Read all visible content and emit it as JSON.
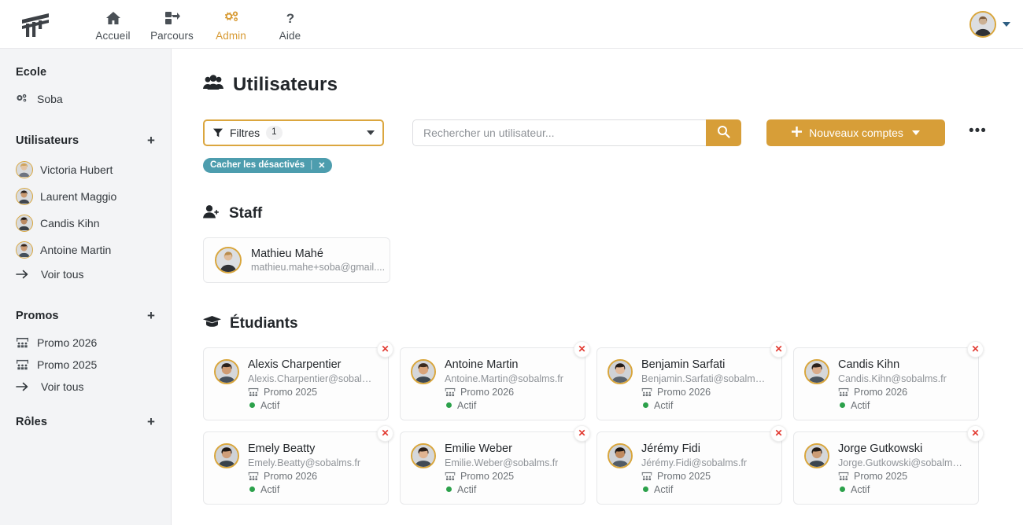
{
  "topnav": {
    "logo": "soba-logo",
    "items": [
      {
        "label": "Accueil",
        "icon": "home-icon",
        "active": false
      },
      {
        "label": "Parcours",
        "icon": "path-icon",
        "active": false
      },
      {
        "label": "Admin",
        "icon": "gears-icon",
        "active": true
      },
      {
        "label": "Aide",
        "icon": "question-icon",
        "active": false
      }
    ],
    "user_menu_caret": "caret-down-icon"
  },
  "sidebar": {
    "school": {
      "title": "Ecole",
      "items": [
        {
          "label": "Soba",
          "icon": "gears-icon"
        }
      ]
    },
    "users": {
      "title": "Utilisateurs",
      "add_label": "+",
      "items": [
        {
          "label": "Victoria Hubert"
        },
        {
          "label": "Laurent Maggio"
        },
        {
          "label": "Candis Kihn"
        },
        {
          "label": "Antoine Martin"
        }
      ],
      "see_all": "Voir tous"
    },
    "promos": {
      "title": "Promos",
      "add_label": "+",
      "items": [
        {
          "label": "Promo 2026"
        },
        {
          "label": "Promo 2025"
        }
      ],
      "see_all": "Voir tous"
    },
    "roles": {
      "title": "Rôles",
      "add_label": "+"
    }
  },
  "main": {
    "page_title": "Utilisateurs",
    "page_title_icon": "users-group-icon",
    "toolbar": {
      "filters_label": "Filtres",
      "filters_count": "1",
      "filters_icon": "funnel-icon",
      "search_placeholder": "Rechercher un utilisateur...",
      "search_value": "",
      "search_icon": "search-icon",
      "new_accounts_label": "Nouveaux comptes",
      "new_accounts_icon": "plus-icon",
      "more_label": "•••"
    },
    "active_filter_chip": {
      "label": "Cacher les désactivés",
      "separator": "|",
      "remove": "✕"
    },
    "staff_section": {
      "title": "Staff",
      "icon": "user-add-icon",
      "members": [
        {
          "name": "Mathieu Mahé",
          "email": "mathieu.mahe+soba@gmail...."
        }
      ]
    },
    "students_section": {
      "title": "Étudiants",
      "icon": "graduation-cap-icon",
      "promo_icon": "classroom-icon",
      "status_label": "Actif",
      "delete_label": "✕",
      "students": [
        {
          "name": "Alexis Charpentier",
          "email": "Alexis.Charpentier@sobalm...",
          "promo": "Promo 2025",
          "status": "Actif"
        },
        {
          "name": "Antoine Martin",
          "email": "Antoine.Martin@sobalms.fr",
          "promo": "Promo 2026",
          "status": "Actif"
        },
        {
          "name": "Benjamin Sarfati",
          "email": "Benjamin.Sarfati@sobalms.fr",
          "promo": "Promo 2026",
          "status": "Actif"
        },
        {
          "name": "Candis Kihn",
          "email": "Candis.Kihn@sobalms.fr",
          "promo": "Promo 2026",
          "status": "Actif"
        },
        {
          "name": "Emely Beatty",
          "email": "Emely.Beatty@sobalms.fr",
          "promo": "Promo 2026",
          "status": "Actif"
        },
        {
          "name": "Emilie Weber",
          "email": "Emilie.Weber@sobalms.fr",
          "promo": "Promo 2025",
          "status": "Actif"
        },
        {
          "name": "Jérémy Fidi",
          "email": "Jérémy.Fidi@sobalms.fr",
          "promo": "Promo 2025",
          "status": "Actif"
        },
        {
          "name": "Jorge Gutkowski",
          "email": "Jorge.Gutkowski@sobalms.fr",
          "promo": "Promo 2025",
          "status": "Actif"
        }
      ]
    }
  },
  "colors": {
    "accent": "#d79e38",
    "chip_teal": "#4d9dae",
    "status_green": "#2ca14b",
    "delete_red": "#e23b32",
    "sidebar_bg": "#f3f4f6"
  }
}
